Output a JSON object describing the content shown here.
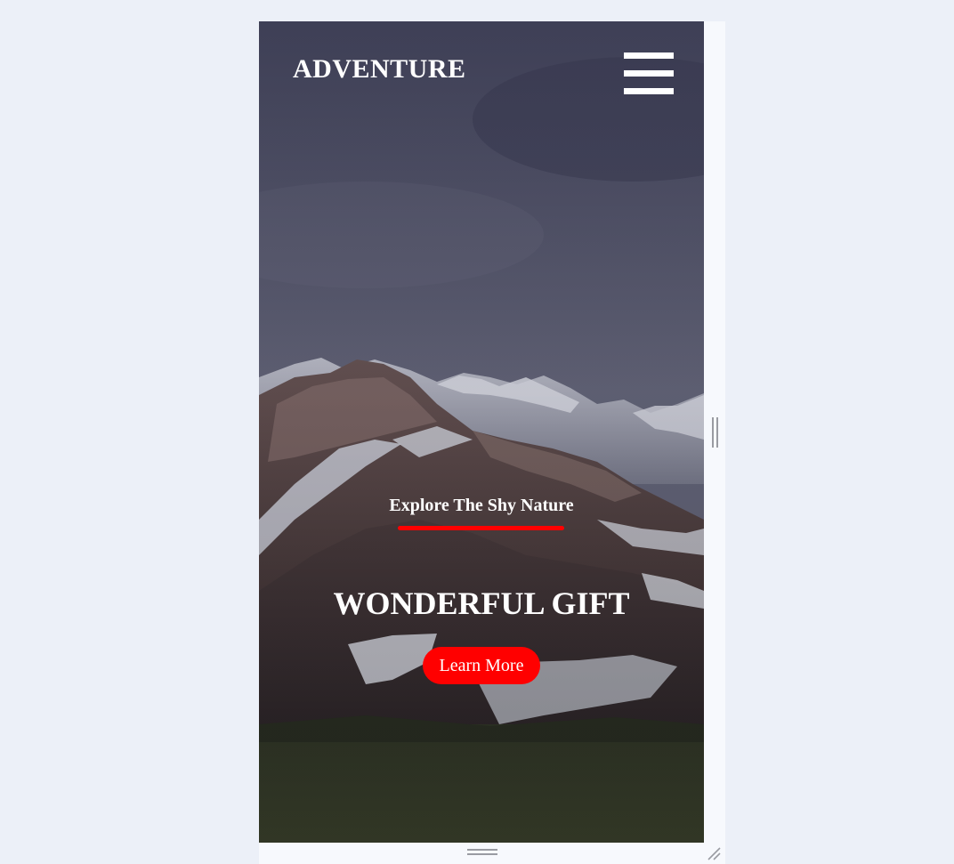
{
  "header": {
    "logo_text": "ADVENTURE",
    "menu_icon": "hamburger-menu-icon"
  },
  "hero": {
    "subtitle": "Explore The Shy Nature",
    "title": "WONDERFUL GIFT",
    "cta_label": "Learn More",
    "accent_color": "#ff0000",
    "background_image": "snowy-mountain-landscape"
  },
  "device_frame": {
    "side_resize_icon": "vertical-drag-handle-icon",
    "bottom_resize_icon": "horizontal-drag-handle-icon",
    "corner_resize_icon": "resize-corner-icon"
  }
}
